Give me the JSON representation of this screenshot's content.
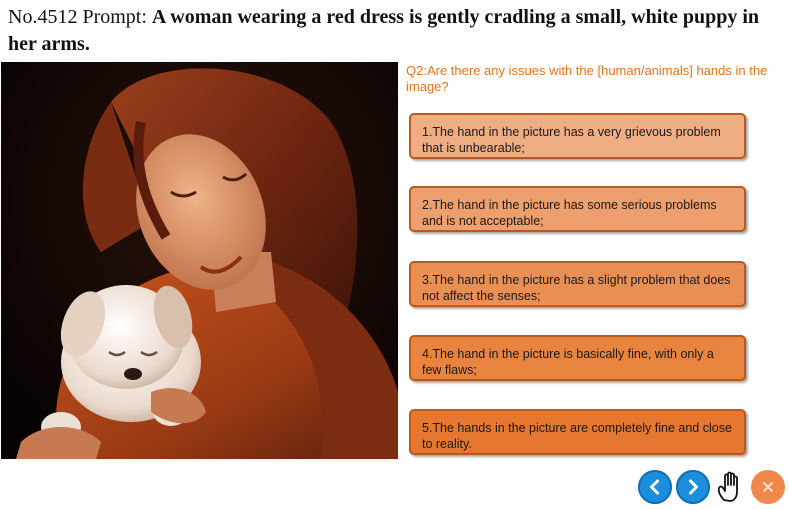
{
  "header": {
    "number": "No.4512",
    "prompt_label": "Prompt:",
    "prompt_text": "A woman wearing a red dress is gently cradling a small, white puppy in her arms."
  },
  "question": "Q2:Are there any issues with the [human/animals] hands in the image?",
  "options": [
    {
      "label": "1.The hand in the picture has a very grievous problem that is unbearable;"
    },
    {
      "label": "2.The hand in the picture has some serious problems and is not acceptable;"
    },
    {
      "label": "3.The hand in the picture has a slight problem that does not affect the senses;"
    },
    {
      "label": "4.The hand in the picture is basically fine, with only a few flaws;"
    },
    {
      "label": "5.The hands in the picture are completely fine and close to reality."
    }
  ],
  "icons": {
    "prev": "chevron-left-icon",
    "next": "chevron-right-icon",
    "hand": "hand-pointer-icon",
    "close": "close-icon"
  },
  "colors": {
    "question_text": "#e2741f",
    "nav_blue": "#1b8fdc",
    "close_orange": "#f0884a"
  }
}
